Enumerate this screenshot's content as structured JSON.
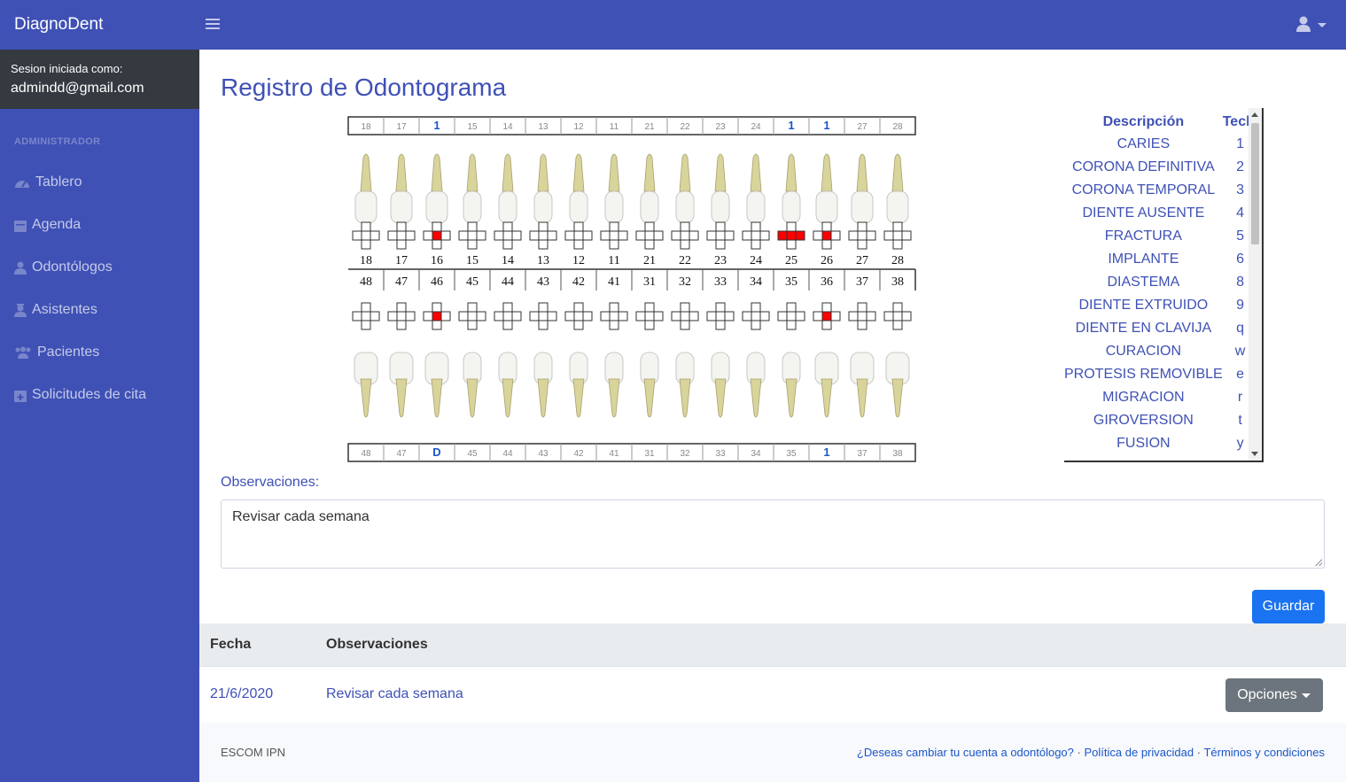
{
  "app": {
    "brand": "DiagnoDent"
  },
  "sidebar": {
    "session_label": "Sesion iniciada como:",
    "session_email": "admindd@gmail.com",
    "heading": "ADMINISTRADOR",
    "items": [
      {
        "label": "Tablero",
        "icon": "tachometer-icon"
      },
      {
        "label": "Agenda",
        "icon": "calendar-icon"
      },
      {
        "label": "Odontólogos",
        "icon": "user-md-icon"
      },
      {
        "label": "Asistentes",
        "icon": "user-nurse-icon"
      },
      {
        "label": "Pacientes",
        "icon": "users-icon"
      },
      {
        "label": "Solicitudes de cita",
        "icon": "calendar-plus-icon"
      }
    ]
  },
  "page": {
    "title": "Registro de Odontograma"
  },
  "odontogram": {
    "top_marks": [
      "18",
      "17",
      "1",
      "15",
      "14",
      "13",
      "12",
      "11",
      "21",
      "22",
      "23",
      "24",
      "1",
      "1",
      "27",
      "28"
    ],
    "upper_numbers": [
      "18",
      "17",
      "16",
      "15",
      "14",
      "13",
      "12",
      "11",
      "21",
      "22",
      "23",
      "24",
      "25",
      "26",
      "27",
      "28"
    ],
    "lower_numbers": [
      "48",
      "47",
      "46",
      "45",
      "44",
      "43",
      "42",
      "41",
      "31",
      "32",
      "33",
      "34",
      "35",
      "36",
      "37",
      "38"
    ],
    "bottom_marks": [
      "48",
      "47",
      "D",
      "45",
      "44",
      "43",
      "42",
      "41",
      "31",
      "32",
      "33",
      "34",
      "35",
      "1",
      "37",
      "38"
    ],
    "upper_caries": [
      "16:center",
      "25:center+left+right",
      "26:center"
    ],
    "lower_caries": [
      "46:center",
      "36:center"
    ],
    "caries_color": "#ff0000"
  },
  "legend": {
    "col_desc": "Descripción",
    "col_key": "Tecla",
    "rows": [
      {
        "desc": "CARIES",
        "key": "1"
      },
      {
        "desc": "CORONA DEFINITIVA",
        "key": "2"
      },
      {
        "desc": "CORONA TEMPORAL",
        "key": "3"
      },
      {
        "desc": "DIENTE AUSENTE",
        "key": "4"
      },
      {
        "desc": "FRACTURA",
        "key": "5"
      },
      {
        "desc": "IMPLANTE",
        "key": "6"
      },
      {
        "desc": "DIASTEMA",
        "key": "8"
      },
      {
        "desc": "DIENTE EXTRUIDO",
        "key": "9"
      },
      {
        "desc": "DIENTE EN CLAVIJA",
        "key": "q"
      },
      {
        "desc": "CURACION",
        "key": "w"
      },
      {
        "desc": "PROTESIS REMOVIBLE",
        "key": "e"
      },
      {
        "desc": "MIGRACION",
        "key": "r"
      },
      {
        "desc": "GIROVERSION",
        "key": "t"
      },
      {
        "desc": "FUSION",
        "key": "y"
      }
    ]
  },
  "form": {
    "obs_label": "Observaciones:",
    "obs_value": "Revisar cada semana",
    "save_label": "Guardar"
  },
  "history": {
    "col_date": "Fecha",
    "col_obs": "Observaciones",
    "rows": [
      {
        "date": "21/6/2020",
        "obs": "Revisar cada semana"
      }
    ],
    "options_label": "Opciones"
  },
  "footer": {
    "left": "ESCOM IPN",
    "link_switch": "¿Deseas cambiar tu cuenta a odontólogo?",
    "link_privacy": "Política de privacidad",
    "link_terms": "Términos y condiciones",
    "separator": "·"
  }
}
